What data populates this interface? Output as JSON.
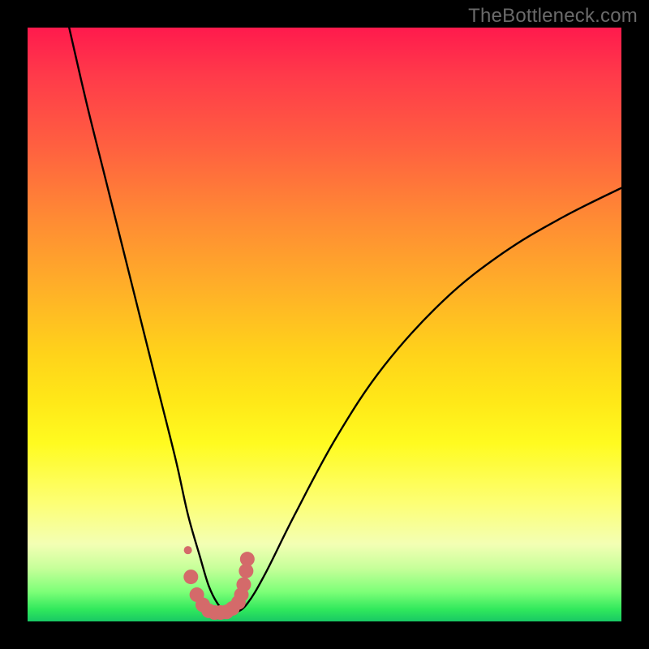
{
  "watermark": "TheBottleneck.com",
  "chart_data": {
    "type": "line",
    "title": "",
    "xlabel": "",
    "ylabel": "",
    "xlim": [
      0,
      100
    ],
    "ylim": [
      0,
      100
    ],
    "series": [
      {
        "name": "bottleneck-curve",
        "x": [
          7,
          10,
          13,
          16,
          19,
          22,
          25,
          27,
          29,
          30.5,
          32,
          33.5,
          35,
          37,
          40,
          45,
          52,
          60,
          70,
          80,
          90,
          100
        ],
        "y": [
          100,
          87,
          75,
          63,
          51,
          39,
          27,
          18,
          11,
          6,
          3,
          1.5,
          1.5,
          3,
          8,
          18,
          31,
          43,
          54,
          62,
          68,
          73
        ]
      }
    ],
    "highlight": {
      "name": "highlight-dots",
      "color": "#d46a6a",
      "x": [
        27.0,
        27.5,
        28.5,
        29.5,
        30.5,
        31.5,
        32.5,
        33.5,
        34.5,
        35.5,
        36.0,
        36.4,
        36.8,
        37.0
      ],
      "y": [
        12.0,
        7.5,
        4.5,
        2.8,
        1.8,
        1.5,
        1.5,
        1.6,
        2.2,
        3.2,
        4.5,
        6.2,
        8.5,
        10.5
      ],
      "radius": [
        5,
        9,
        9,
        9,
        9,
        9,
        9,
        9,
        9,
        9,
        9,
        9,
        9,
        9
      ]
    }
  }
}
